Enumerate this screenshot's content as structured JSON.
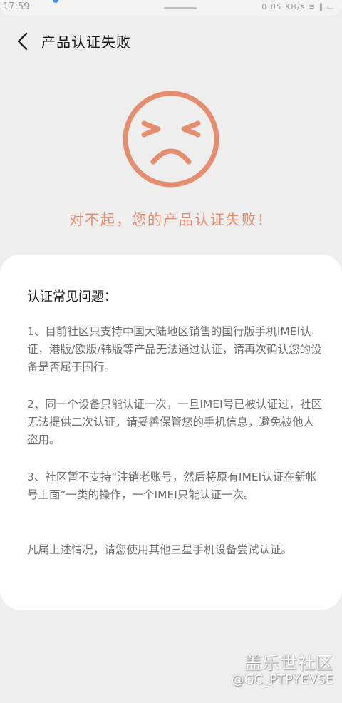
{
  "status_bar": {
    "time": "17:59",
    "right_text": "0.05 KB/s  ≋  ∥  ▭"
  },
  "header": {
    "title": "产品认证失败"
  },
  "result": {
    "message": "对不起，您的产品认证失败！"
  },
  "faq": {
    "title": "认证常见问题：",
    "paragraphs": [
      "1、目前社区只支持中国大陆地区销售的国行版手机IMEI认证，港版/欧版/韩版等产品无法通过认证，请再次确认您的设备是否属于国行。",
      "2、同一个设备只能认证一次，一旦IMEI号已被认证过，社区无法提供二次认证，请妥善保管您的手机信息，避免被他人盗用。",
      "3、社区暂不支持“注销老账号，然后将原有IMEI认证在新帐号上面”一类的操作，一个IMEI只能认证一次。",
      "凡属上述情况，请您使用其他三星手机设备尝试认证。"
    ]
  },
  "watermark": {
    "line1": "盖乐世社区",
    "line2": "@GC_PTPYEVSE"
  },
  "colors": {
    "accent": "#e58e6f",
    "background": "#eeeeef",
    "card": "#ffffff"
  },
  "icons": {
    "back": "chevron-left-icon",
    "face": "sad-face-icon"
  }
}
